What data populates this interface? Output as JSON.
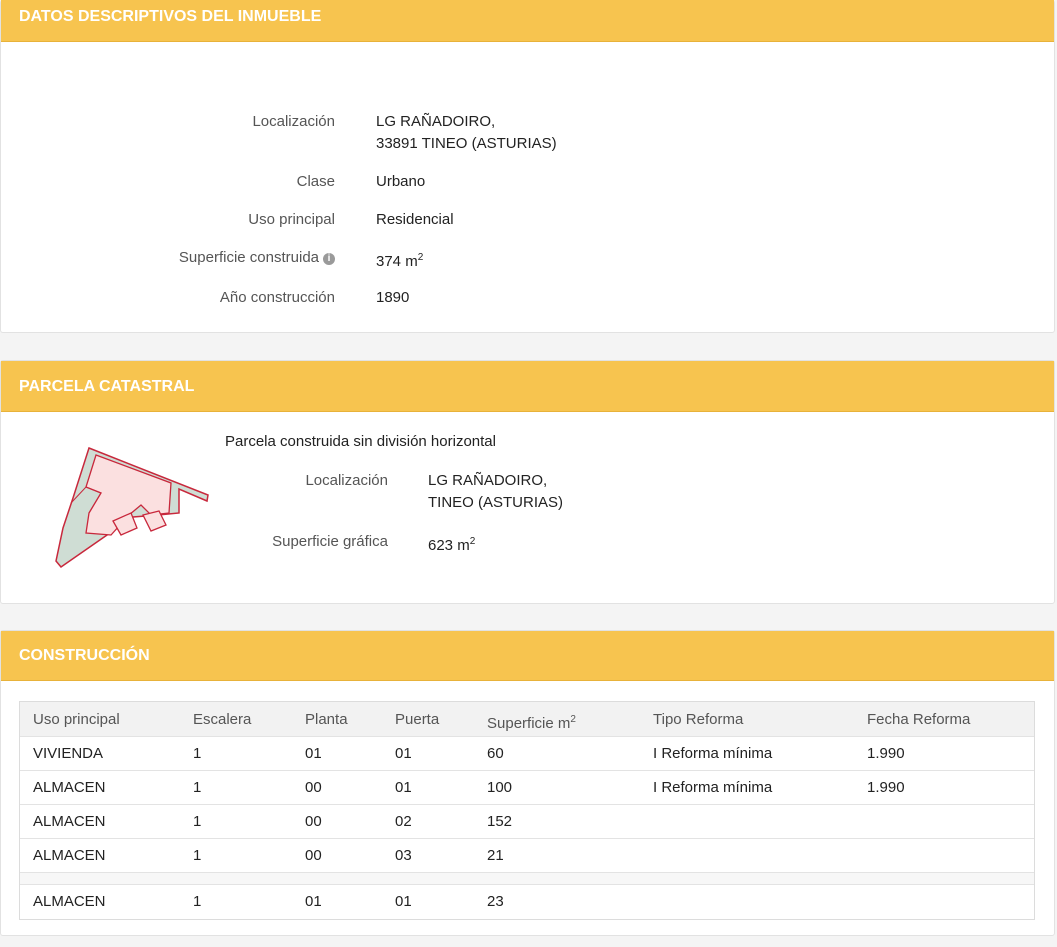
{
  "datos": {
    "title": "DATOS DESCRIPTIVOS DEL INMUEBLE",
    "localizacion_label": "Localización",
    "localizacion_line1": "LG RAÑADOIRO,",
    "localizacion_line2": "33891 TINEO (ASTURIAS)",
    "clase_label": "Clase",
    "clase_value": "Urbano",
    "uso_label": "Uso principal",
    "uso_value": "Residencial",
    "superficie_label": "Superficie construida",
    "superficie_value": "374 m",
    "superficie_sup": "2",
    "anio_label": "Año construcción",
    "anio_value": "1890"
  },
  "parcela": {
    "title": "PARCELA CATASTRAL",
    "subtitle": "Parcela construida sin división horizontal",
    "localizacion_label": "Localización",
    "localizacion_line1": "LG RAÑADOIRO,",
    "localizacion_line2": "TINEO (ASTURIAS)",
    "superficie_label": "Superficie gráfica",
    "superficie_value": "623 m",
    "superficie_sup": "2"
  },
  "construccion": {
    "title": "CONSTRUCCIÓN",
    "headers": [
      "Uso principal",
      "Escalera",
      "Planta",
      "Puerta",
      "Superficie m",
      "Tipo Reforma",
      "Fecha Reforma"
    ],
    "header_sup": "2",
    "rows": [
      [
        "VIVIENDA",
        "1",
        "01",
        "01",
        "60",
        "I Reforma mínima",
        "1.990"
      ],
      [
        "ALMACEN",
        "1",
        "00",
        "01",
        "100",
        "I Reforma mínima",
        "1.990"
      ],
      [
        "ALMACEN",
        "1",
        "00",
        "02",
        "152",
        "",
        ""
      ],
      [
        "ALMACEN",
        "1",
        "00",
        "03",
        "21",
        "",
        ""
      ],
      [
        "ALMACEN",
        "1",
        "01",
        "01",
        "23",
        "",
        ""
      ]
    ]
  },
  "colors": {
    "header": "#f7c44f",
    "parcel_outline": "#c8283c",
    "parcel_fill": "#fbe0e0",
    "parcel_green": "#cfddd4"
  }
}
